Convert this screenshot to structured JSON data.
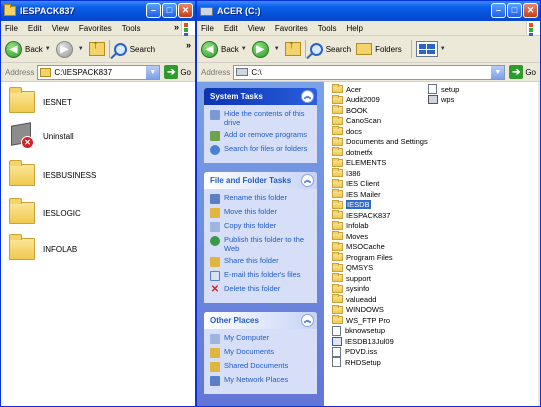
{
  "left_window": {
    "title": "IESPACK837",
    "menu": [
      "File",
      "Edit",
      "View",
      "Favorites",
      "Tools"
    ],
    "menu_more": "»",
    "toolbar": {
      "back": "Back",
      "search": "Search",
      "more": "»"
    },
    "address": {
      "label": "Address",
      "value": "C:\\IESPACK837",
      "go": "Go"
    },
    "items": [
      {
        "label": "IESNET",
        "icon": "folder-icon"
      },
      {
        "label": "Uninstall",
        "icon": "uninstall-icon"
      },
      {
        "label": "IESBUSINESS",
        "icon": "folder-icon"
      },
      {
        "label": "IESLOGIC",
        "icon": "folder-icon"
      },
      {
        "label": "INFOLAB",
        "icon": "folder-icon"
      }
    ]
  },
  "right_window": {
    "title": "ACER (C:)",
    "menu": [
      "File",
      "Edit",
      "View",
      "Favorites",
      "Tools",
      "Help"
    ],
    "toolbar": {
      "back": "Back",
      "search": "Search",
      "folders": "Folders"
    },
    "address": {
      "label": "Address",
      "value": "C:\\",
      "go": "Go"
    },
    "panels": {
      "system_tasks": {
        "title": "System Tasks",
        "items": [
          "Hide the contents of this drive",
          "Add or remove programs",
          "Search for files or folders"
        ]
      },
      "file_folder_tasks": {
        "title": "File and Folder Tasks",
        "items": [
          "Rename this folder",
          "Move this folder",
          "Copy this folder",
          "Publish this folder to the Web",
          "Share this folder",
          "E-mail this folder's files",
          "Delete this folder"
        ]
      },
      "other_places": {
        "title": "Other Places",
        "items": [
          "My Computer",
          "My Documents",
          "Shared Documents",
          "My Network Places"
        ]
      }
    },
    "files_col1": [
      {
        "name": "Acer",
        "type": "folder"
      },
      {
        "name": "Audit2009",
        "type": "folder"
      },
      {
        "name": "BOOK",
        "type": "folder"
      },
      {
        "name": "CanoScan",
        "type": "folder"
      },
      {
        "name": "docs",
        "type": "folder"
      },
      {
        "name": "Documents and Settings",
        "type": "folder"
      },
      {
        "name": "dotnetfx",
        "type": "folder"
      },
      {
        "name": "ELEMENTS",
        "type": "folder"
      },
      {
        "name": "I386",
        "type": "folder"
      },
      {
        "name": "IES Client",
        "type": "folder"
      },
      {
        "name": "IES Mailer",
        "type": "folder"
      },
      {
        "name": "IESDB",
        "type": "folder",
        "selected": true
      },
      {
        "name": "IESPACK837",
        "type": "folder"
      },
      {
        "name": "Infolab",
        "type": "folder"
      },
      {
        "name": "Moves",
        "type": "folder"
      },
      {
        "name": "MSOCache",
        "type": "folder"
      },
      {
        "name": "Program Files",
        "type": "folder"
      },
      {
        "name": "QMSYS",
        "type": "folder"
      },
      {
        "name": "support",
        "type": "folder"
      },
      {
        "name": "sysinfo",
        "type": "folder"
      },
      {
        "name": "valueadd",
        "type": "folder"
      },
      {
        "name": "WINDOWS",
        "type": "folder"
      },
      {
        "name": "WS_FTP Pro",
        "type": "folder"
      },
      {
        "name": "bknowsetup",
        "type": "file"
      },
      {
        "name": "IESDB13Jul09",
        "type": "app"
      },
      {
        "name": "PDVD.iss",
        "type": "file"
      },
      {
        "name": "RHDSetup",
        "type": "file"
      }
    ],
    "files_col2": [
      {
        "name": "setup",
        "type": "file"
      },
      {
        "name": "wps",
        "type": "setup"
      }
    ]
  },
  "colors": {
    "title_bar": "#0a5fe8",
    "task_pane": "#6f8de0",
    "link": "#215dc6",
    "selection": "#316ac5"
  }
}
